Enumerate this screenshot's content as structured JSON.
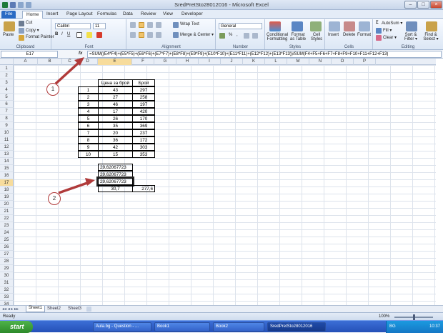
{
  "window": {
    "title": "SredPretSto28012016 - Microsoft Excel"
  },
  "tabs": [
    "File",
    "Home",
    "Insert",
    "Page Layout",
    "Formulas",
    "Data",
    "Review",
    "View",
    "Developer"
  ],
  "ribbon": {
    "clipboard": {
      "paste": "Paste",
      "cut": "Cut",
      "copy": "Copy ▾",
      "format_painter": "Format Painter",
      "label": "Clipboard"
    },
    "font": {
      "name": "Calibri",
      "size": "11",
      "label": "Font"
    },
    "alignment": {
      "wrap": "Wrap Text",
      "merge": "Merge & Center ▾",
      "label": "Alignment"
    },
    "number": {
      "format": "General",
      "label": "Number",
      "pct": "%"
    },
    "styles": {
      "cond": "Conditional Formatting",
      "table": "Format as Table",
      "cell": "Cell Styles",
      "label": "Styles"
    },
    "cells": {
      "insert": "Insert",
      "delete": "Delete",
      "format": "Format",
      "label": "Cells"
    },
    "editing": {
      "autosum": "AutoSum ▾",
      "fill": "Fill ▾",
      "clear": "Clear ▾",
      "sort": "Sort & Filter ▾",
      "find": "Find & Select ▾",
      "label": "Editing"
    }
  },
  "formula_bar": {
    "name": "E17",
    "fx": "fx",
    "formula": "=SUM((E4*F4)+(E5*F5)+(E6*F6)+(E7*F7)+(E8*F8)+(E9*F9)+(E10*F10)+(E11*F11)+(E12*F12)+(E13*F13))/SUM(F4+F5+F6+F7+F8+F9+F10+F11+F12+F13)"
  },
  "columns": [
    "A",
    "B",
    "C",
    "D",
    "E",
    "F",
    "G",
    "H",
    "I",
    "J",
    "K",
    "L",
    "M",
    "N",
    "O",
    "P"
  ],
  "table": {
    "headers": [
      "Цена за брой",
      "Брой"
    ],
    "rows": [
      [
        "1",
        "43",
        "297"
      ],
      [
        "2",
        "27",
        "258"
      ],
      [
        "3",
        "46",
        "197"
      ],
      [
        "4",
        "17",
        "420"
      ],
      [
        "5",
        "26",
        "170"
      ],
      [
        "6",
        "35",
        "369"
      ],
      [
        "7",
        "20",
        "237"
      ],
      [
        "8",
        "36",
        "172"
      ],
      [
        "9",
        "42",
        "303"
      ],
      [
        "10",
        "15",
        "353"
      ]
    ]
  },
  "results": {
    "e15": "29,62067723",
    "e16": "29,62067723",
    "e17": "29,62067723",
    "e18": "30,7",
    "f18": "277,6"
  },
  "callouts": [
    "1",
    "2"
  ],
  "sheets": [
    "Sheet1",
    "Sheet2",
    "Sheet3"
  ],
  "status": {
    "ready": "Ready",
    "zoom": "100%"
  },
  "taskbar": {
    "start": "start",
    "items": [
      "Aula.bg - Question - ...",
      "Book1",
      "Book2",
      "SredPretSto28012016"
    ],
    "lang": "BG",
    "clock": "10:37"
  }
}
